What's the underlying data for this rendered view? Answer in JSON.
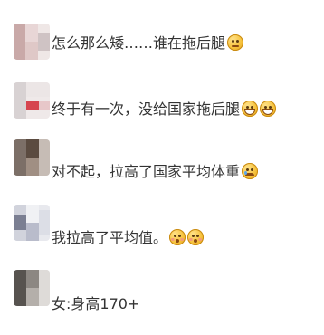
{
  "comments": [
    {
      "text": "怎么那么矮……谁在拖后腿",
      "emojis": [
        "annoyed-face-icon"
      ]
    },
    {
      "text": "终于有一次，没给国家拖后腿",
      "emojis": [
        "grinning-face-icon",
        "grinning-face-icon"
      ]
    },
    {
      "text": "对不起，拉高了国家平均体重",
      "emojis": [
        "sad-face-icon"
      ]
    },
    {
      "text": "我拉高了平均值。",
      "emojis": [
        "shocked-face-icon",
        "shocked-face-icon"
      ]
    },
    {
      "text": "女:身高170+",
      "emojis": []
    }
  ]
}
